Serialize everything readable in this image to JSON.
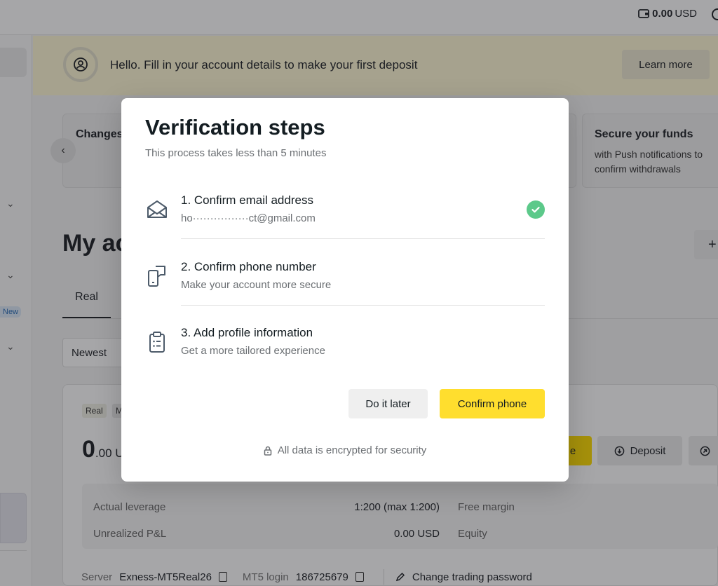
{
  "header": {
    "balance_amount": "0.00",
    "balance_currency": "USD"
  },
  "banner": {
    "message": "Hello. Fill in your account details to make your first deposit",
    "learn_more": "Learn more"
  },
  "promos": {
    "left_title": "Changes",
    "right_title": "Secure your funds",
    "right_desc": "with Push notifications to confirm withdrawals"
  },
  "left_rail": {
    "new_badge": "New"
  },
  "accounts": {
    "heading": "My ac",
    "tab_real": "Real",
    "sort": "Newest",
    "badge_real": "Real",
    "badge_m": "M",
    "balance_int": "0",
    "balance_dec": ".00 U",
    "trade_label": "e",
    "deposit_label": "Deposit",
    "stats": {
      "leverage_label": "Actual leverage",
      "leverage_value": "1:200 (max 1:200)",
      "pnl_label": "Unrealized P&L",
      "pnl_value": "0.00 USD",
      "free_margin_label": "Free margin",
      "equity_label": "Equity"
    },
    "footer": {
      "server_label": "Server",
      "server_value": "Exness-MT5Real26",
      "login_label": "MT5 login",
      "login_value": "186725679",
      "change_password": "Change trading password"
    }
  },
  "modal": {
    "title": "Verification steps",
    "subtitle": "This process takes less than 5 minutes",
    "steps": [
      {
        "title": "1. Confirm email address",
        "desc": "ho················ct@gmail.com",
        "icon": "envelope-open-icon",
        "done": true
      },
      {
        "title": "2. Confirm phone number",
        "desc": "Make your account more secure",
        "icon": "phone-icon",
        "done": false
      },
      {
        "title": "3. Add profile information",
        "desc": "Get a more tailored experience",
        "icon": "clipboard-icon",
        "done": false
      }
    ],
    "do_later": "Do it later",
    "confirm_phone": "Confirm phone",
    "security_note": "All data is encrypted for security"
  },
  "colors": {
    "accent": "#ffde2e",
    "success": "#5cc98a",
    "overlay": "rgba(20,22,26,0.38)"
  }
}
